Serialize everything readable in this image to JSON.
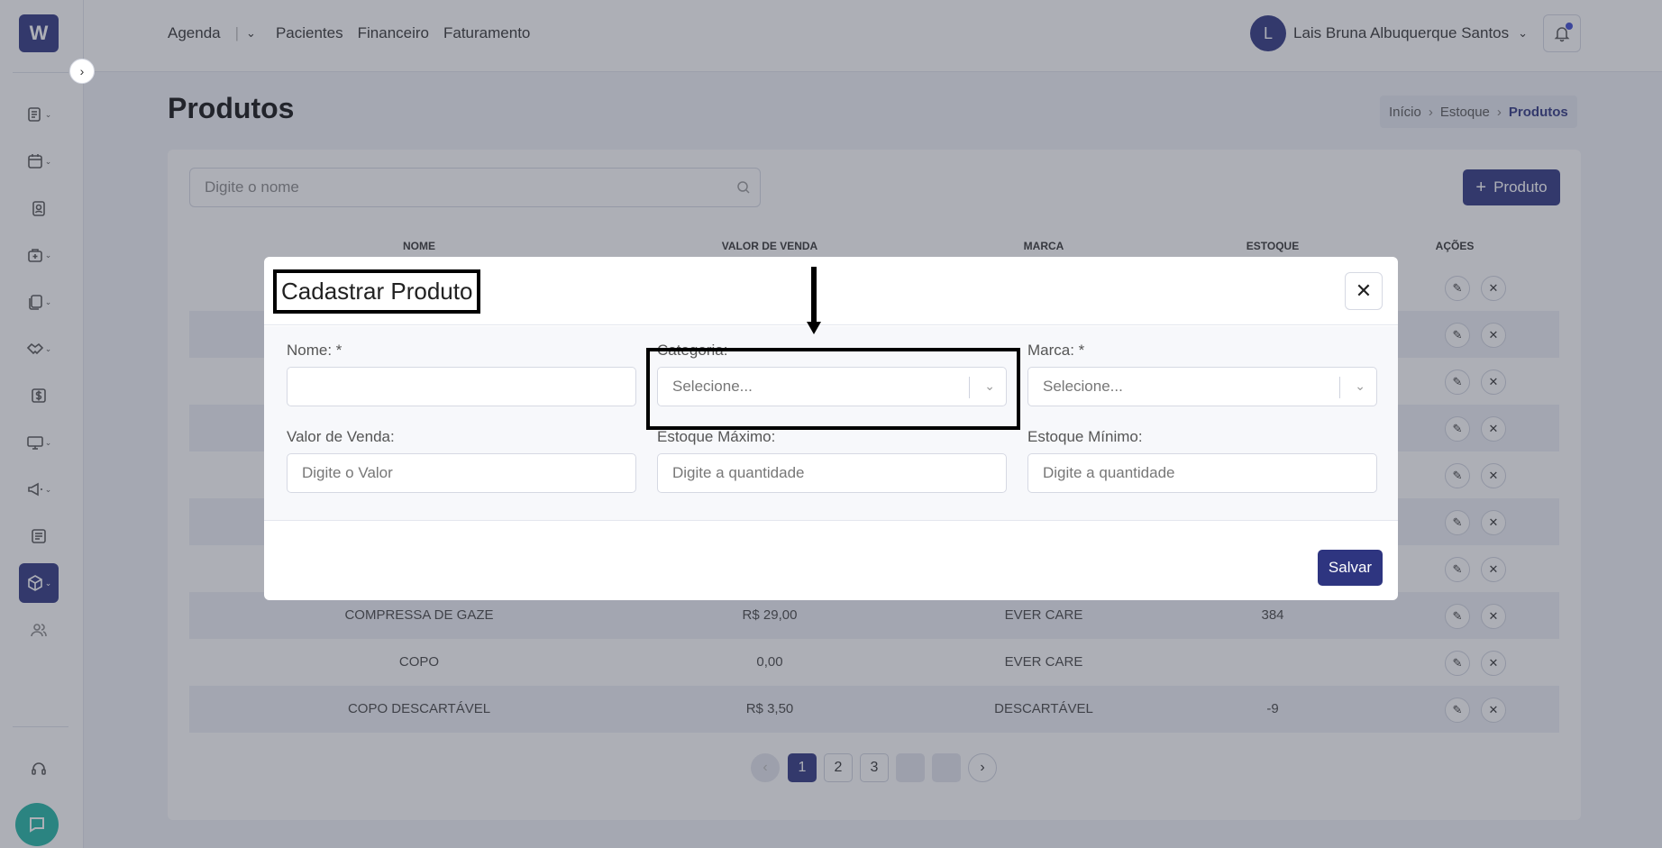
{
  "app": {
    "logo_text": "W"
  },
  "nav": {
    "items": [
      "Agenda",
      "Pacientes",
      "Financeiro",
      "Faturamento"
    ]
  },
  "user": {
    "initial": "L",
    "name": "Lais Bruna Albuquerque Santos"
  },
  "page": {
    "title": "Produtos"
  },
  "breadcrumb": {
    "items": [
      "Início",
      "Estoque",
      "Produtos"
    ]
  },
  "search": {
    "placeholder": "Digite o nome"
  },
  "toolbar": {
    "add_label": "Produto"
  },
  "table": {
    "headers": [
      "NOME",
      "VALOR DE VENDA",
      "MARCA",
      "ESTOQUE",
      "AÇÕES"
    ],
    "rows": [
      {
        "nome": "COMPRESSA DE GAZE",
        "valor": "R$ 29,00",
        "marca": "EVER CARE",
        "estoque": "384"
      },
      {
        "nome": "COPO",
        "valor": "0,00",
        "marca": "EVER CARE",
        "estoque": ""
      },
      {
        "nome": "COPO DESCARTÁVEL",
        "valor": "R$ 3,50",
        "marca": "DESCARTÁVEL",
        "estoque": "-9"
      }
    ]
  },
  "pagination": {
    "pages": [
      "1",
      "2",
      "3"
    ],
    "current": "1"
  },
  "modal": {
    "title": "Cadastrar Produto",
    "fields": {
      "nome": {
        "label": "Nome: *",
        "value": ""
      },
      "categoria": {
        "label": "Categoria:",
        "placeholder": "Selecione..."
      },
      "marca": {
        "label": "Marca: *",
        "placeholder": "Selecione..."
      },
      "valor_venda": {
        "label": "Valor de Venda:",
        "placeholder": "Digite o Valor"
      },
      "estoque_maximo": {
        "label": "Estoque Máximo:",
        "placeholder": "Digite a quantidade"
      },
      "estoque_minimo": {
        "label": "Estoque Mínimo:",
        "placeholder": "Digite a quantidade"
      }
    },
    "save_label": "Salvar"
  },
  "colors": {
    "primary": "#2e3580",
    "chat": "#1fb5a4",
    "notification_dot": "#3d4ad0"
  }
}
